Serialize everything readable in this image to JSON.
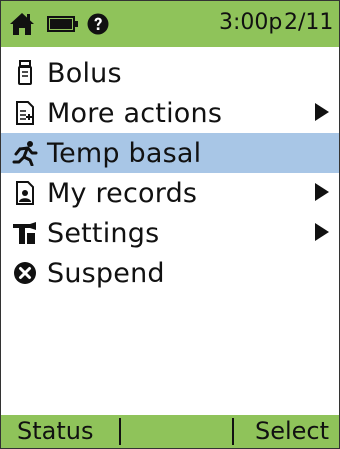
{
  "status_bar": {
    "time": "3:00p",
    "date": "2/11",
    "icons": [
      "home-icon",
      "battery-icon",
      "help-icon"
    ],
    "color": "#8fc35a"
  },
  "menu": {
    "items": [
      {
        "label": "Bolus",
        "icon": "vial-icon",
        "has_submenu": false,
        "selected": false
      },
      {
        "label": "More actions",
        "icon": "document-list-icon",
        "has_submenu": true,
        "selected": false
      },
      {
        "label": "Temp basal",
        "icon": "running-person-icon",
        "has_submenu": false,
        "selected": true
      },
      {
        "label": "My records",
        "icon": "person-record-icon",
        "has_submenu": true,
        "selected": false
      },
      {
        "label": "Settings",
        "icon": "wrench-icon",
        "has_submenu": true,
        "selected": false
      },
      {
        "label": "Suspend",
        "icon": "stop-icon",
        "has_submenu": false,
        "selected": false
      }
    ],
    "selection_color": "#a8c6e6"
  },
  "softkeys": {
    "left": "Status",
    "right": "Select"
  }
}
